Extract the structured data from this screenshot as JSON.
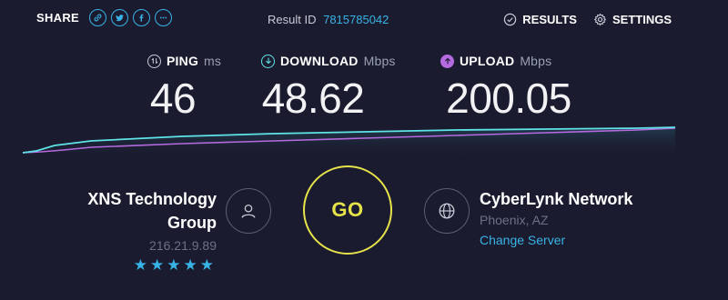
{
  "header": {
    "share_label": "SHARE",
    "share_icons": [
      "link-icon",
      "twitter-icon",
      "facebook-icon",
      "more-icon"
    ],
    "result_label": "Result ID",
    "result_id": "7815785042",
    "results_label": "RESULTS",
    "settings_label": "SETTINGS"
  },
  "metrics": {
    "ping": {
      "label": "PING",
      "unit": "ms",
      "value": "46",
      "icon": "ping-icon"
    },
    "download": {
      "label": "DOWNLOAD",
      "unit": "Mbps",
      "value": "48.62",
      "icon": "download-icon"
    },
    "upload": {
      "label": "UPLOAD",
      "unit": "Mbps",
      "value": "200.05",
      "icon": "upload-icon"
    }
  },
  "isp": {
    "name_line1": "XNS Technology",
    "name_line2": "Group",
    "ip": "216.21.9.89",
    "rating": "★★★★★"
  },
  "go_label": "GO",
  "server": {
    "name": "CyberLynk Network",
    "location": "Phoenix, AZ",
    "change_label": "Change Server"
  },
  "colors": {
    "background": "#1b1b2f",
    "accent_blue": "#38b3e5",
    "go_yellow": "#e6e34a",
    "upload_purple": "#b56ae0",
    "download_cyan": "#5ee3e6"
  }
}
